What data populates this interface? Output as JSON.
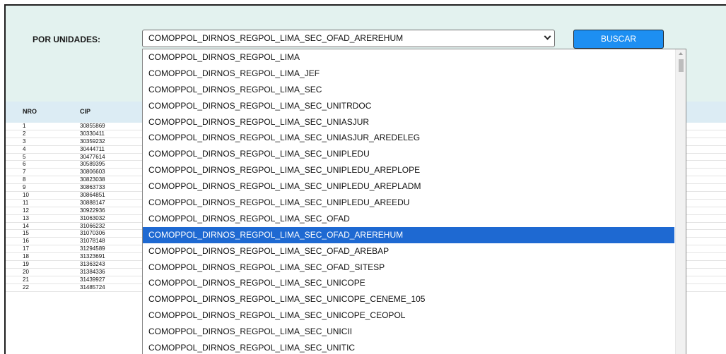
{
  "filter": {
    "label": "POR UNIDADES:",
    "selected_value": "COMOPPOL_DIRNOS_REGPOL_LIMA_SEC_OFAD_AREREHUM",
    "search_button": "BUSCAR"
  },
  "table": {
    "headers": {
      "nro": "NRO",
      "cip": "CIP"
    },
    "rows": [
      {
        "nro": "1",
        "cip": "30855869"
      },
      {
        "nro": "2",
        "cip": "30330411"
      },
      {
        "nro": "3",
        "cip": "30359232"
      },
      {
        "nro": "4",
        "cip": "30444711"
      },
      {
        "nro": "5",
        "cip": "30477614"
      },
      {
        "nro": "6",
        "cip": "30589395"
      },
      {
        "nro": "7",
        "cip": "30806603"
      },
      {
        "nro": "8",
        "cip": "30823038"
      },
      {
        "nro": "9",
        "cip": "30863733"
      },
      {
        "nro": "10",
        "cip": "30864851"
      },
      {
        "nro": "11",
        "cip": "30888147"
      },
      {
        "nro": "12",
        "cip": "30922936"
      },
      {
        "nro": "13",
        "cip": "31063032"
      },
      {
        "nro": "14",
        "cip": "31066232"
      },
      {
        "nro": "15",
        "cip": "31070306"
      },
      {
        "nro": "16",
        "cip": "31078148"
      },
      {
        "nro": "17",
        "cip": "31294589"
      },
      {
        "nro": "18",
        "cip": "31323691"
      },
      {
        "nro": "19",
        "cip": "31363243"
      },
      {
        "nro": "20",
        "cip": "31384336"
      },
      {
        "nro": "21",
        "cip": "31439927"
      },
      {
        "nro": "22",
        "cip": "31485724"
      }
    ]
  },
  "dropdown": {
    "selected_index": 11,
    "options": [
      "COMOPPOL_DIRNOS_REGPOL_LIMA",
      "COMOPPOL_DIRNOS_REGPOL_LIMA_JEF",
      "COMOPPOL_DIRNOS_REGPOL_LIMA_SEC",
      "COMOPPOL_DIRNOS_REGPOL_LIMA_SEC_UNITRDOC",
      "COMOPPOL_DIRNOS_REGPOL_LIMA_SEC_UNIASJUR",
      "COMOPPOL_DIRNOS_REGPOL_LIMA_SEC_UNIASJUR_AREDELEG",
      "COMOPPOL_DIRNOS_REGPOL_LIMA_SEC_UNIPLEDU",
      "COMOPPOL_DIRNOS_REGPOL_LIMA_SEC_UNIPLEDU_AREPLOPE",
      "COMOPPOL_DIRNOS_REGPOL_LIMA_SEC_UNIPLEDU_AREPLADM",
      "COMOPPOL_DIRNOS_REGPOL_LIMA_SEC_UNIPLEDU_AREEDU",
      "COMOPPOL_DIRNOS_REGPOL_LIMA_SEC_OFAD",
      "COMOPPOL_DIRNOS_REGPOL_LIMA_SEC_OFAD_AREREHUM",
      "COMOPPOL_DIRNOS_REGPOL_LIMA_SEC_OFAD_AREBAP",
      "COMOPPOL_DIRNOS_REGPOL_LIMA_SEC_OFAD_SITESP",
      "COMOPPOL_DIRNOS_REGPOL_LIMA_SEC_UNICOPE",
      "COMOPPOL_DIRNOS_REGPOL_LIMA_SEC_UNICOPE_CENEME_105",
      "COMOPPOL_DIRNOS_REGPOL_LIMA_SEC_UNICOPE_CEOPOL",
      "COMOPPOL_DIRNOS_REGPOL_LIMA_SEC_UNICII",
      "COMOPPOL_DIRNOS_REGPOL_LIMA_SEC_UNITIC"
    ]
  }
}
